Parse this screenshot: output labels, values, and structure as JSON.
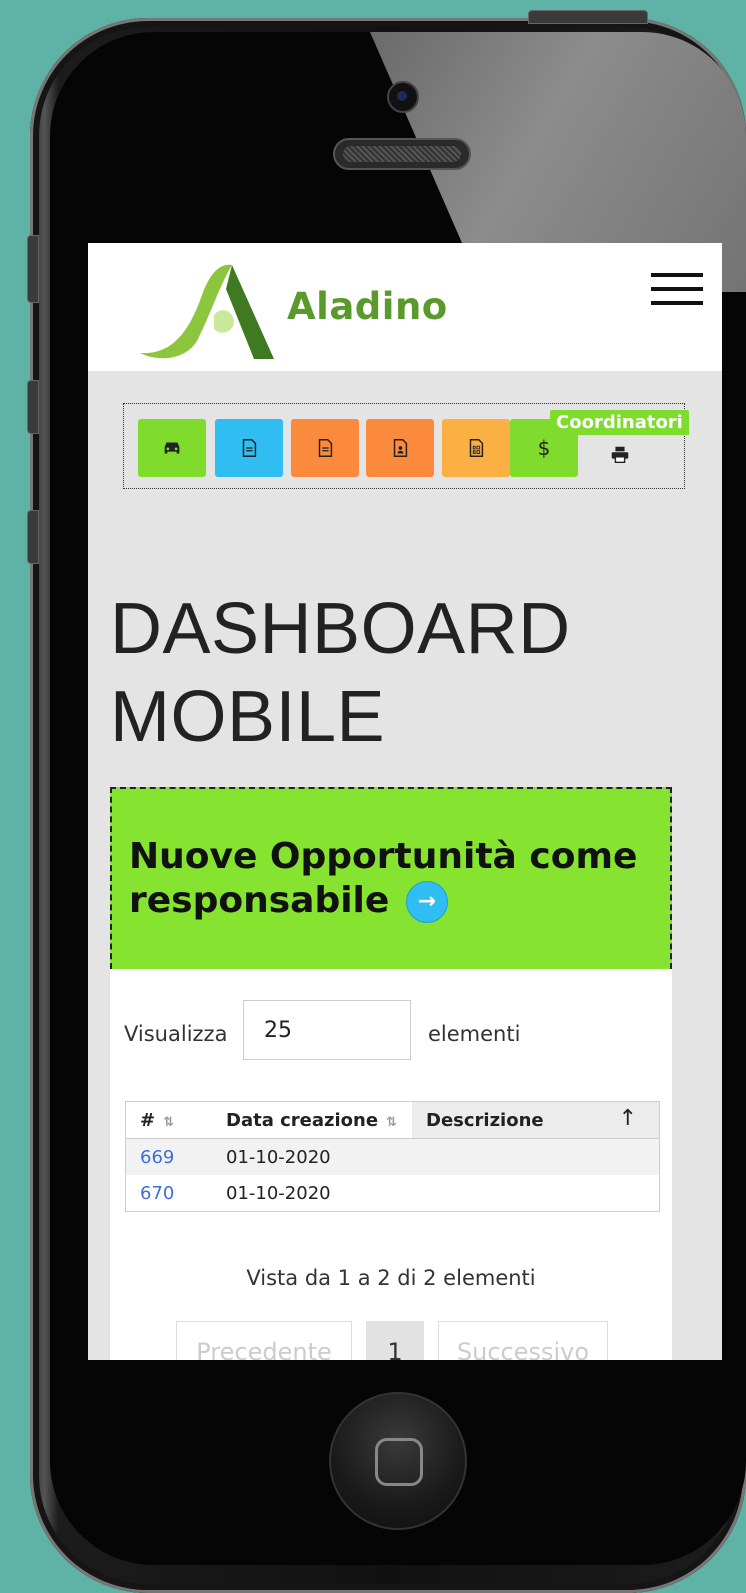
{
  "app": {
    "brand": "Aladino"
  },
  "toolbar": {
    "badge": "Coordinatori",
    "buttons": [
      {
        "name": "car-icon",
        "color": "#7fdb2c"
      },
      {
        "name": "document-icon",
        "color": "#2fbdf2"
      },
      {
        "name": "document-icon",
        "color": "#fb8a3c"
      },
      {
        "name": "file-user-icon",
        "color": "#fb8a3c"
      },
      {
        "name": "file-code-icon",
        "color": "#fbb044"
      },
      {
        "name": "dollar-icon",
        "color": "#7fdb2c",
        "label": "$"
      },
      {
        "name": "printer-icon",
        "color": "transparent"
      }
    ]
  },
  "page": {
    "title_line1": "DASHBOARD",
    "title_line2": "MOBILE"
  },
  "opportunities": {
    "title": "Nuove Opportunità come responsabile",
    "arrow": "→"
  },
  "table_controls": {
    "show_label": "Visualizza",
    "show_value": "25",
    "show_unit": "elementi"
  },
  "table": {
    "columns": [
      "#",
      "Data creazione",
      "Descrizione"
    ],
    "sort_icon": "⇅",
    "sort_up_icon": "↑",
    "rows": [
      {
        "id": "669",
        "date": "01-10-2020",
        "desc": ""
      },
      {
        "id": "670",
        "date": "01-10-2020",
        "desc": ""
      }
    ]
  },
  "pagination": {
    "info": "Vista da 1 a 2 di 2 elementi",
    "prev": "Precedente",
    "current": "1",
    "next": "Successivo"
  },
  "colors": {
    "accent_green": "#86e32f",
    "brand_green": "#5a9a2c",
    "link_blue": "#3a6fd8",
    "background": "#5fb3a6"
  }
}
